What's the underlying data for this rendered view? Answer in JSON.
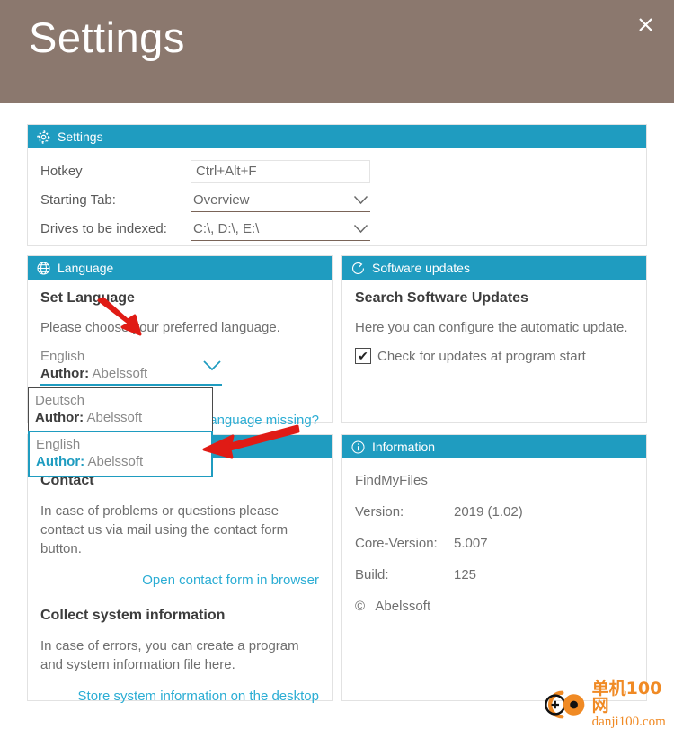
{
  "window": {
    "title": "Settings",
    "close_label": "✕",
    "header_color": "#8b786e",
    "accent_color": "#1f9cc0",
    "link_color": "#2badd4"
  },
  "settings_panel": {
    "icon": "gear-icon",
    "title": "Settings",
    "rows": [
      {
        "label": "Hotkey",
        "value": "Ctrl+Alt+F",
        "type": "text"
      },
      {
        "label": "Starting Tab:",
        "value": "Overview",
        "type": "dropdown"
      },
      {
        "label": "Drives to be indexed:",
        "value": "C:\\, D:\\, E:\\",
        "type": "dropdown"
      }
    ]
  },
  "language_panel": {
    "icon": "globe-icon",
    "title": "Language",
    "heading": "Set Language",
    "description": "Please choose your preferred language.",
    "selected": {
      "name": "English",
      "author_label": "Author:",
      "author": "Abelssoft"
    },
    "missing_link": "Language missing?",
    "dropdown_open": true,
    "options": [
      {
        "name": "Deutsch",
        "author_label": "Author:",
        "author": "Abelssoft",
        "selected": false
      },
      {
        "name": "English",
        "author_label": "Author:",
        "author": "Abelssoft",
        "selected": true
      }
    ]
  },
  "updates_panel": {
    "icon": "refresh-icon",
    "title": "Software updates",
    "heading": "Search Software Updates",
    "description": "Here you can configure the automatic update.",
    "checkbox": {
      "label": "Check for updates at program start",
      "checked": true,
      "mark": "✔"
    }
  },
  "contact_panel": {
    "heading": "Contact",
    "description": "In case of problems or questions please contact us via mail using the contact form button.",
    "contact_link": "Open contact form in browser",
    "collect_heading": "Collect system information",
    "collect_description": "In case of errors, you can create a program and system information file here.",
    "collect_link": "Store system information on the desktop"
  },
  "information_panel": {
    "icon": "info-icon",
    "title": "Information",
    "app_name": "FindMyFiles",
    "rows": [
      {
        "key": "Version:",
        "value": "2019 (1.02)"
      },
      {
        "key": "Core-Version:",
        "value": "5.007"
      },
      {
        "key": "Build:",
        "value": "125"
      }
    ],
    "copyright_symbol": "©",
    "copyright": "Abelssoft"
  },
  "watermark": {
    "cn": "单机100网",
    "en": "danji100.com",
    "color": "#f08a24"
  }
}
